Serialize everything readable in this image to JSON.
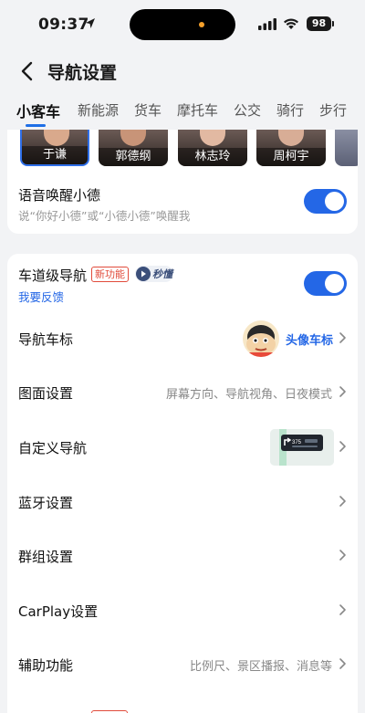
{
  "status_bar": {
    "time": "09:37",
    "battery": "98",
    "island_dot_color": "#f6a12b"
  },
  "header": {
    "title": "导航设置"
  },
  "tabs": [
    {
      "label": "小客车",
      "active": true
    },
    {
      "label": "新能源"
    },
    {
      "label": "货车"
    },
    {
      "label": "摩托车"
    },
    {
      "label": "公交"
    },
    {
      "label": "骑行"
    },
    {
      "label": "步行"
    }
  ],
  "voice_packs": [
    {
      "name": "于谦",
      "selected": true
    },
    {
      "name": "郭德纲"
    },
    {
      "name": "林志玲"
    },
    {
      "name": "周柯宇"
    }
  ],
  "voice_wake": {
    "title": "语音唤醒小德",
    "subtitle": "说“你好小德”或“小德小德”唤醒我",
    "enabled": true
  },
  "lane_nav": {
    "title": "车道级导航",
    "new_badge": "新功能",
    "speed_badge": "秒懂",
    "feedback": "我要反馈",
    "enabled": true
  },
  "settings_rows": {
    "nav_icon": {
      "label": "导航车标",
      "value": "头像车标"
    },
    "map_display": {
      "label": "图面设置",
      "value": "屏幕方向、导航视角、日夜模式"
    },
    "custom_nav": {
      "label": "自定义导航",
      "preview_text": "375"
    },
    "bluetooth": {
      "label": "蓝牙设置"
    },
    "group": {
      "label": "群组设置"
    },
    "carplay": {
      "label": "CarPlay设置"
    },
    "assist": {
      "label": "辅助功能",
      "value": "比例尺、景区播报、消息等"
    }
  },
  "colors": {
    "accent": "#2467e6",
    "badge_red": "#e14b3b",
    "background": "#f2f3f5"
  }
}
